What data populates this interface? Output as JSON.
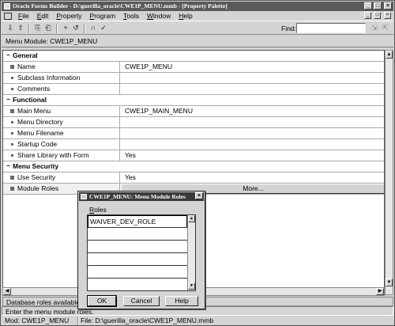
{
  "window": {
    "title": "Oracle Forms Builder - D:\\guerilla_oracle\\CWE1P_MENU.mmb - [Property Palette]",
    "controls": [
      "_",
      "□",
      "×"
    ]
  },
  "menubar": {
    "items": [
      "File",
      "Edit",
      "Property",
      "Program",
      "Tools",
      "Window",
      "Help"
    ],
    "mdi_controls": [
      "_",
      "□",
      "×"
    ]
  },
  "toolbar": {
    "find_label": "Find:",
    "find_value": "",
    "tools": [
      {
        "name": "expand-icon",
        "glyph": "⇩"
      },
      {
        "name": "collapse-icon",
        "glyph": "⇧"
      },
      {
        "name": "copy-property-icon",
        "glyph": "⎘"
      },
      {
        "name": "paste-property-icon",
        "glyph": "⎗"
      },
      {
        "name": "add-property-icon",
        "glyph": "+"
      },
      {
        "name": "inherit-icon",
        "glyph": "↺"
      },
      {
        "name": "intersection-icon",
        "glyph": "∩"
      },
      {
        "name": "union-icon",
        "glyph": "✓"
      }
    ]
  },
  "module_bar": {
    "label": "Menu Module: CWE1P_MENU"
  },
  "properties": {
    "sections": [
      {
        "title": "General",
        "rows": [
          {
            "name": "Name",
            "value": "CWE1P_MENU"
          },
          {
            "name": "Subclass Information",
            "value": ""
          },
          {
            "name": "Comments",
            "value": ""
          }
        ]
      },
      {
        "title": "Functional",
        "rows": [
          {
            "name": "Main Menu",
            "value": "CWE1P_MAIN_MENU"
          },
          {
            "name": "Menu Directory",
            "value": ""
          },
          {
            "name": "Menu Filename",
            "value": ""
          },
          {
            "name": "Startup Code",
            "value": ""
          },
          {
            "name": "Share Library with Form",
            "value": "Yes"
          }
        ]
      },
      {
        "title": "Menu Security",
        "rows": [
          {
            "name": "Use Security",
            "value": "Yes"
          },
          {
            "name": "Module Roles",
            "value": "More..."
          }
        ]
      }
    ]
  },
  "hint_bar": {
    "text": "Database roles available"
  },
  "status": {
    "message": "Enter the menu module roles.",
    "mod": "Mod: CWE1P_MENU",
    "file": "File: D:\\guerilla_oracle\\CWE1P_MENU.mmb"
  },
  "dialog": {
    "title": "CWE1P_MENU: Menu Module Roles",
    "close": "×",
    "roles_label": "Roles",
    "roles": [
      "WAIVER_DEV_ROLE",
      "",
      "",
      "",
      "",
      ""
    ],
    "buttons": {
      "ok": "OK",
      "cancel": "Cancel",
      "help": "Help"
    }
  }
}
